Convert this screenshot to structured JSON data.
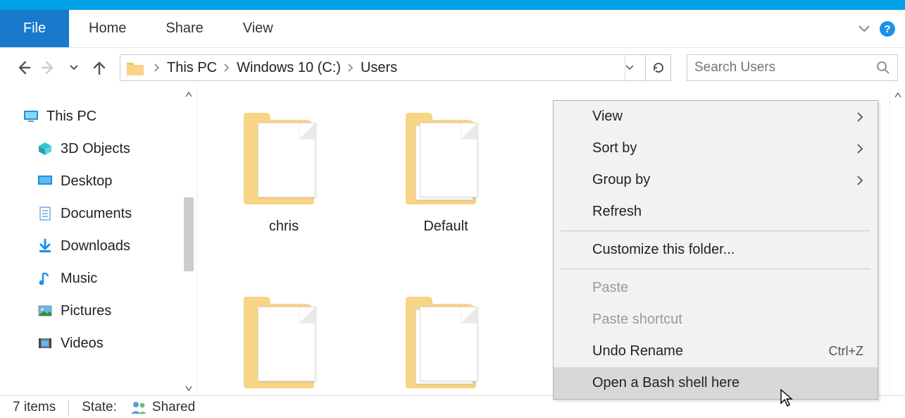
{
  "ribbon": {
    "file": "File",
    "tabs": [
      "Home",
      "Share",
      "View"
    ]
  },
  "breadcrumbs": [
    "This PC",
    "Windows 10 (C:)",
    "Users"
  ],
  "search": {
    "placeholder": "Search Users"
  },
  "sidebar": {
    "root": "This PC",
    "items": [
      "3D Objects",
      "Desktop",
      "Documents",
      "Downloads",
      "Music",
      "Pictures",
      "Videos"
    ]
  },
  "folders": [
    "chris",
    "Default"
  ],
  "context_menu": {
    "items": [
      {
        "label": "View",
        "submenu": true
      },
      {
        "label": "Sort by",
        "submenu": true
      },
      {
        "label": "Group by",
        "submenu": true
      },
      {
        "label": "Refresh"
      },
      {
        "sep": true
      },
      {
        "label": "Customize this folder..."
      },
      {
        "sep": true
      },
      {
        "label": "Paste",
        "disabled": true
      },
      {
        "label": "Paste shortcut",
        "disabled": true
      },
      {
        "label": "Undo Rename",
        "shortcut": "Ctrl+Z"
      },
      {
        "label": "Open a Bash shell here",
        "hover": true
      }
    ]
  },
  "status": {
    "count": "7 items",
    "state_label": "State:",
    "state_value": "Shared"
  }
}
